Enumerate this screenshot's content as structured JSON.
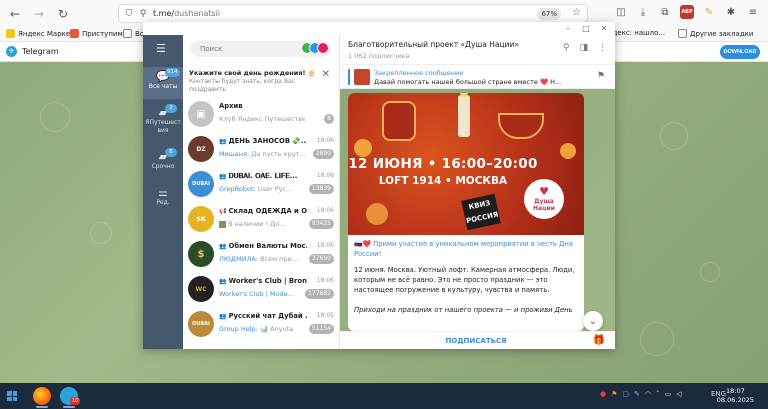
{
  "browser": {
    "url_host": "t.me/",
    "url_path": "dushanatsii",
    "zoom": "67%",
    "bookmarks": [
      {
        "label": "Яндекс Маркет",
        "color": "#f5c518"
      },
      {
        "label": "Приступим",
        "color": "#e8573a"
      },
      {
        "label": "Во",
        "color": "#888888"
      }
    ],
    "bookmarks_right": [
      {
        "label": "Яндекс: нашло..."
      },
      {
        "label": "Другие закладки"
      }
    ]
  },
  "tg_header": {
    "title": "Telegram",
    "download": "DOWNLOAD"
  },
  "rail": {
    "items": [
      {
        "label": "Все чаты",
        "badge": "914"
      },
      {
        "label": "ЯПутешест вия",
        "badge": "2"
      },
      {
        "label": "Срочно",
        "badge": "6"
      },
      {
        "label": "Ред.",
        "badge": ""
      }
    ]
  },
  "chats": {
    "search_placeholder": "Поиск",
    "birthday_title": "Укажите свой день рождения! 🎂",
    "birthday_sub": "Контакты будут знать, когда Вас поздравить",
    "list": [
      {
        "name": "Архив",
        "time": "",
        "sender": "",
        "preview": "Клуб Яндекс Путешествен...",
        "badge": "8",
        "avatar_color": "#c4c4c4",
        "avatar_text": "▣"
      },
      {
        "name": "ДЕНЬ ЗАНОСОВ 💸...",
        "time": "18:06",
        "sender": "Мишаня:",
        "preview": "Да пусть крут...",
        "badge": "2890",
        "avatar_color": "#6b3a2a",
        "avatar_text": "DZ"
      },
      {
        "name": "𝐃𝐔𝐁𝐀𝐈. 𝐎𝐀𝐄. 𝐋𝐈𝐅𝐄...",
        "time": "18:06",
        "sender": "GrepRobot:",
        "preview": "User Рус...",
        "badge": "13839",
        "avatar_color": "#3a8fd6",
        "avatar_text": "DUBAI"
      },
      {
        "name": "Склад ОДЕЖДА и ОБ...",
        "time": "18:06",
        "sender": "",
        "preview": "В наличии ! Дл...",
        "badge": "83425",
        "avatar_color": "#e6b422",
        "avatar_text": "SK"
      },
      {
        "name": "Обмен Валюты Мос...",
        "time": "18:06",
        "sender": "ЛЮДМИЛА:",
        "preview": "Всем при...",
        "badge": "37690",
        "avatar_color": "#2d4a2b",
        "avatar_text": "$"
      },
      {
        "name": "Worker's Club | Bronze",
        "time": "18:06",
        "sender": "Worker's Club | Mode...",
        "preview": "",
        "badge": "177882",
        "avatar_color": "#222222",
        "avatar_text": "WC"
      },
      {
        "name": "Русский чат Дубай ...",
        "time": "18:05",
        "sender": "Group Help:",
        "preview": "📊 Anyuta",
        "badge": "51154",
        "avatar_color": "#b88a3a",
        "avatar_text": "DUBAI"
      }
    ]
  },
  "channel": {
    "title": "Благотворительный проект «Душа Нации»",
    "subscribers": "1 062 подписчика",
    "pinned_title": "Закрепленное сообщение",
    "pinned_text": "Давай помогать нашей большой стране вместе ❤️  Н...",
    "banner_date": "12 ИЮНЯ • 16:00–20:00",
    "banner_loc": "LOFT 1914 • МОСКВА",
    "quiz": "КВИЗ РОССИЯ",
    "logo_text": "Душа Нации",
    "post_link": "🇷🇺❤️ Прими участие в уникальном мероприятии в честь Дня России!",
    "post_body": "12 июня. Москва. Уютный лофт. Камерная атмосфера. Люди, которым не всё равно. Это не просто праздник — это настоящее погружение в культуру, чувства и память.",
    "post_quote": "Приходи на праздник от нашего проекта — и проживи День",
    "subscribe": "ПОДПИСАТЬСЯ"
  },
  "taskbar": {
    "lang": "ENG",
    "time": "18:07",
    "date": "08.06.2025",
    "tg_badge": "10"
  }
}
